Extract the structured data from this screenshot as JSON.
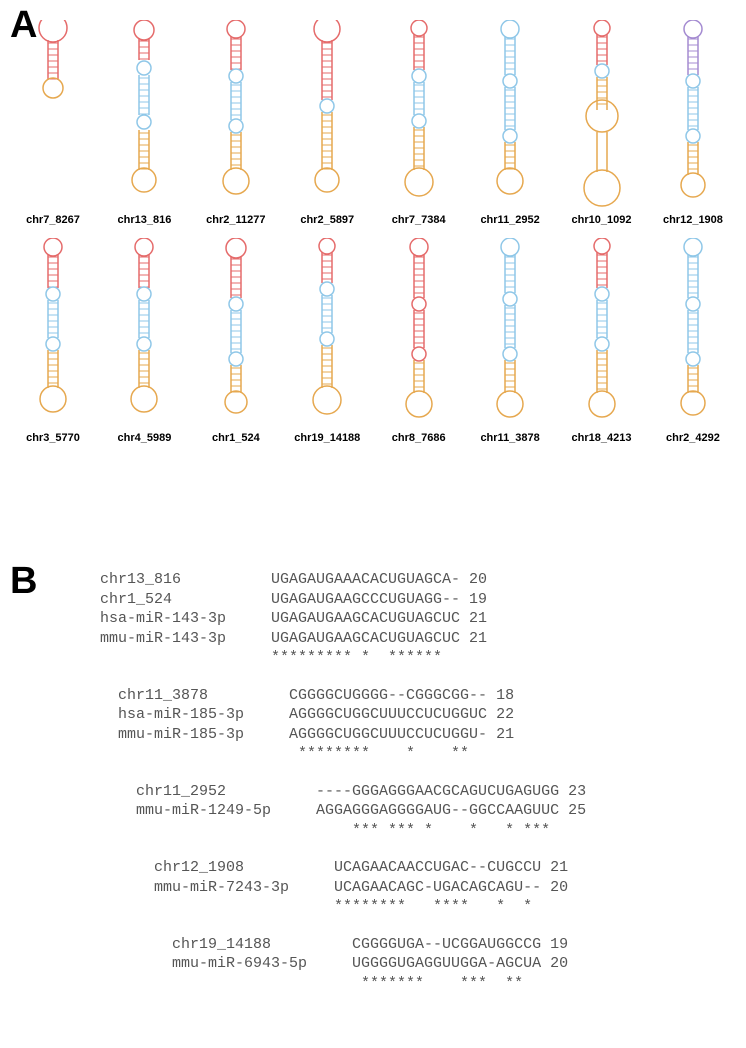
{
  "panels": {
    "a_label": "A",
    "b_label": "B"
  },
  "structures": {
    "row1": [
      {
        "label": "chr7_8267"
      },
      {
        "label": "chr13_816"
      },
      {
        "label": "chr2_11277"
      },
      {
        "label": "chr2_5897"
      },
      {
        "label": "chr7_7384"
      },
      {
        "label": "chr11_2952"
      },
      {
        "label": "chr10_1092"
      },
      {
        "label": "chr12_1908"
      }
    ],
    "row2": [
      {
        "label": "chr3_5770"
      },
      {
        "label": "chr4_5989"
      },
      {
        "label": "chr1_524"
      },
      {
        "label": "chr19_14188"
      },
      {
        "label": "chr8_7686"
      },
      {
        "label": "chr11_3878"
      },
      {
        "label": "chr18_4213"
      },
      {
        "label": "chr2_4292"
      }
    ]
  },
  "alignments": [
    {
      "rows": [
        {
          "name": "chr13_816",
          "seq": "UGAGAUGAAACACUGUAGCA-",
          "len": "20"
        },
        {
          "name": "chr1_524",
          "seq": "UGAGAUGAAGCCCUGUAGG--",
          "len": "19"
        },
        {
          "name": "hsa-miR-143-3p",
          "seq": "UGAGAUGAAGCACUGUAGCUC",
          "len": "21"
        },
        {
          "name": "mmu-miR-143-3p",
          "seq": "UGAGAUGAAGCACUGUAGCUC",
          "len": "21"
        }
      ],
      "cons": "********* *  ******"
    },
    {
      "rows": [
        {
          "name": "chr11_3878",
          "seq": "CGGGGCUGGGG--CGGGCGG--",
          "len": "18"
        },
        {
          "name": "hsa-miR-185-3p",
          "seq": "AGGGGCUGGCUUUCCUCUGGUC",
          "len": "22"
        },
        {
          "name": "mmu-miR-185-3p",
          "seq": "AGGGGCUGGCUUUCCUCUGGU-",
          "len": "21"
        }
      ],
      "cons": " ********    *    **"
    },
    {
      "rows": [
        {
          "name": "chr11_2952",
          "seq": "----GGGAGGGAACGCAGUCUGAGUGG",
          "len": "23"
        },
        {
          "name": "mmu-miR-1249-5p",
          "seq": "AGGAGGGAGGGGAUG--GGCCAAGUUC",
          "len": "25"
        }
      ],
      "cons": "    *** *** *    *   * ***"
    },
    {
      "rows": [
        {
          "name": "chr12_1908",
          "seq": "UCAGAACAACCUGAC--CUGCCU",
          "len": "21"
        },
        {
          "name": "mmu-miR-7243-3p",
          "seq": "UCAGAACAGC-UGACAGCAGU--",
          "len": "20"
        }
      ],
      "cons": "********   ****   *  *"
    },
    {
      "rows": [
        {
          "name": "chr19_14188",
          "seq": "CGGGGUGA--UCGGAUGGCCG",
          "len": "19"
        },
        {
          "name": "mmu-miR-6943-5p",
          "seq": "UGGGGUGAGGUUGGA-AGCUA",
          "len": "20"
        }
      ],
      "cons": " *******    ***  **"
    }
  ]
}
